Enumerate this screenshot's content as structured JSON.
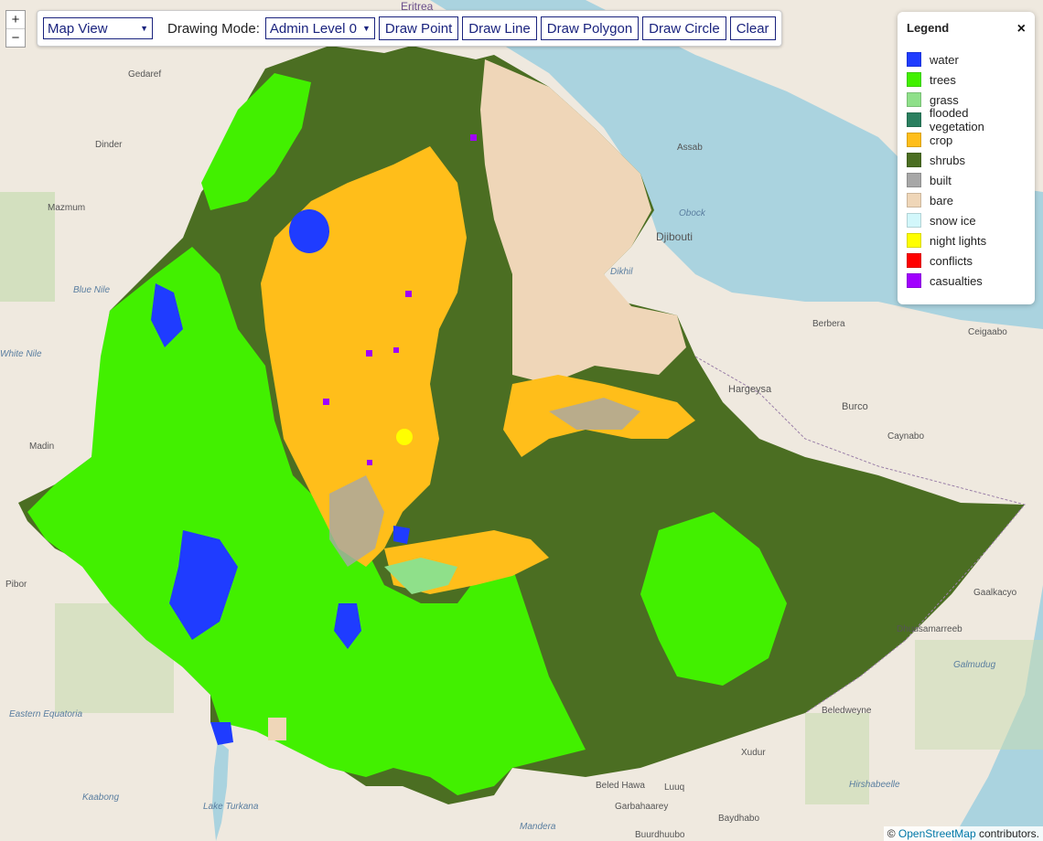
{
  "toolbar": {
    "view_select": "Map View",
    "drawing_mode_label": "Drawing Mode:",
    "admin_select": "Admin Level 0",
    "buttons": [
      "Draw Point",
      "Draw Line",
      "Draw Polygon",
      "Draw Circle",
      "Clear"
    ]
  },
  "zoom": {
    "in": "+",
    "out": "−"
  },
  "legend": {
    "title": "Legend",
    "close": "×",
    "items": [
      {
        "label": "water",
        "color": "#1f3cff"
      },
      {
        "label": "trees",
        "color": "#42f000"
      },
      {
        "label": "grass",
        "color": "#8fe08a"
      },
      {
        "label": "flooded vegetation",
        "color": "#2a7f5f"
      },
      {
        "label": "crop",
        "color": "#ffbe1a"
      },
      {
        "label": "shrubs",
        "color": "#4b6e22"
      },
      {
        "label": "built",
        "color": "#a7a7a7"
      },
      {
        "label": "bare",
        "color": "#efd6b8"
      },
      {
        "label": "snow ice",
        "color": "#d2f7fb"
      },
      {
        "label": "night lights",
        "color": "#ffff00"
      },
      {
        "label": "conflicts",
        "color": "#ff0000"
      },
      {
        "label": "casualties",
        "color": "#a100ff"
      }
    ]
  },
  "attribution": {
    "prefix": "©",
    "link": "OpenStreetMap",
    "suffix": "contributors."
  },
  "places": [
    "Eritrea",
    "Assab",
    "Djibouti",
    "Obock",
    "Dikhil",
    "Berbera",
    "Ceigaabo",
    "Hargeysa",
    "Burco",
    "Caynabo",
    "Gaalkacyo",
    "Dhuusamarreeb",
    "Galmudug",
    "Beledweyne",
    "Xudur",
    "Beled Hawa",
    "Luuq",
    "Garbahaarey",
    "Baydhabo",
    "Buurdhuubo",
    "Hirshabeelle",
    "Mandera",
    "Lake Turkana",
    "Kaabong",
    "Eastern Equatoria",
    "Pibor",
    "Madin",
    "White Nile",
    "Blue Nile",
    "Gedaref",
    "Mazmum",
    "Dinder"
  ]
}
